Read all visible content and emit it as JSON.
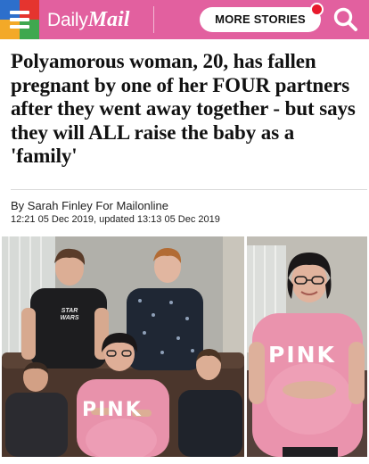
{
  "header": {
    "menu_icon": "hamburger-icon",
    "logo_part1": "Daily",
    "logo_part2": "Mail",
    "more_stories_label": "MORE STORIES",
    "search_icon": "search-icon",
    "brand_color": "#e2609f"
  },
  "article": {
    "headline": "Polyamorous woman, 20, has fallen pregnant by one of her FOUR partners after they went away together - but says they will ALL raise the baby as a 'family'",
    "byline": "By Sarah Finley For Mailonline",
    "dateline": "12:21 05 Dec 2019, updated 13:13 05 Dec 2019"
  },
  "photos": {
    "left": {
      "tshirt_text_1": "PINK",
      "tshirt_text_2": "STAR WARS"
    },
    "right": {
      "tshirt_text": "PINK"
    }
  }
}
